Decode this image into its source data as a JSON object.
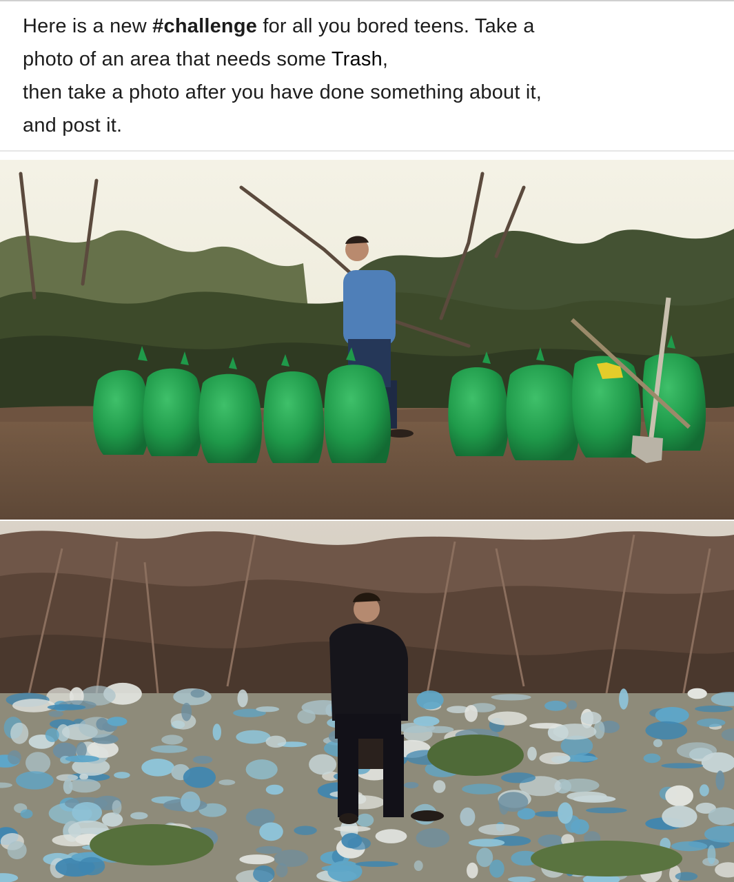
{
  "post": {
    "caption": {
      "line1_prefix": "Here is a new ",
      "hashtag": "#challenge",
      "line1_suffix": " for all you bored teens. Take a",
      "line2_prefix": "photo of an area that needs some ",
      "line2_word": "Trash",
      "line2_suffix": ",",
      "line3": "then take a photo after you have done something about it,",
      "line4": "and post it."
    },
    "photos": [
      {
        "id": "after",
        "bag_color": "#1f9a4a"
      },
      {
        "id": "before",
        "litter_color": "#5ea6c8"
      }
    ],
    "colors": {
      "sky": "#f2f0e4",
      "ground": "#6b5442",
      "foliage": "#3d4a2a",
      "shirt": "#4f7fb8",
      "dark_suit": "#16151b"
    }
  }
}
